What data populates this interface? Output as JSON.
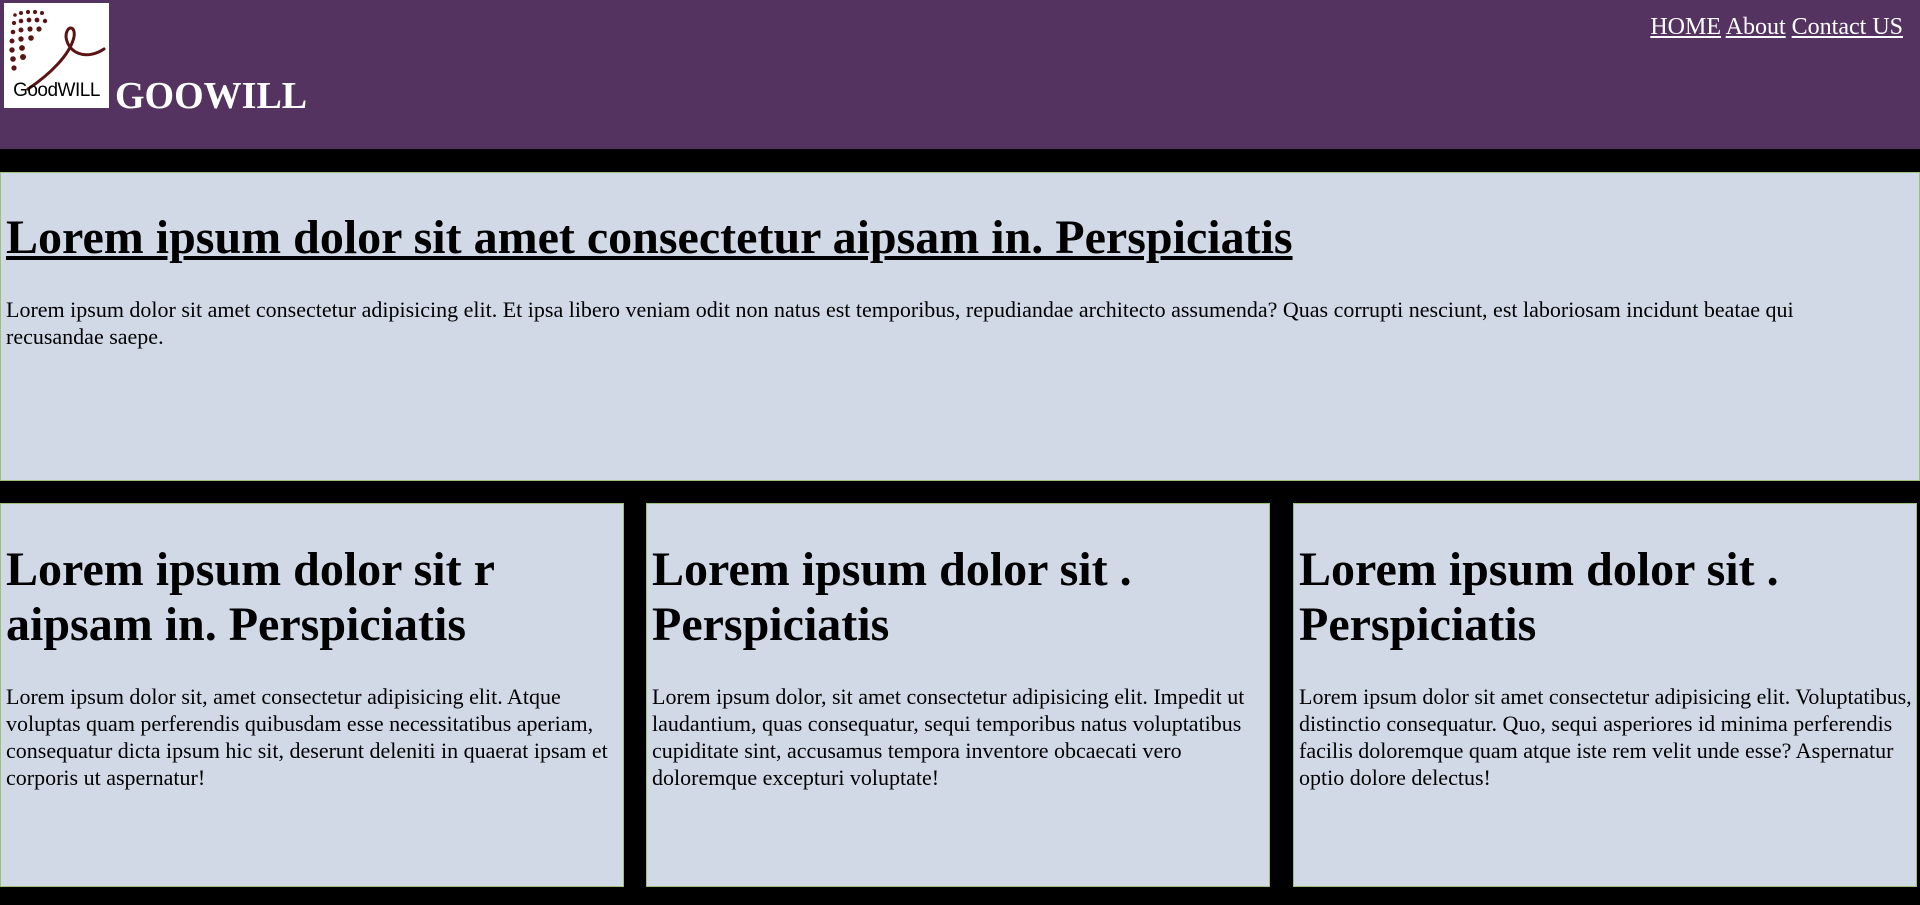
{
  "header": {
    "logo_text": "GoodWILL",
    "brand": "GOOWILL",
    "nav": [
      "HOME",
      "About",
      "Contact US"
    ]
  },
  "hero": {
    "title": "Lorem ipsum dolor sit amet consectetur aipsam in. Perspiciatis",
    "body": "Lorem ipsum dolor sit amet consectetur adipisicing elit. Et ipsa libero veniam odit non natus est temporibus, repudiandae architecto assumenda? Quas corrupti nesciunt, est laboriosam incidunt beatae qui recusandae saepe."
  },
  "cards": [
    {
      "title": "Lorem ipsum dolor sit r aipsam in. Perspiciatis",
      "body": "Lorem ipsum dolor sit, amet consectetur adipisicing elit. Atque voluptas quam perferendis quibusdam esse necessitatibus aperiam, consequatur dicta ipsum hic sit, deserunt deleniti in quaerat ipsam et corporis ut aspernatur!"
    },
    {
      "title": "Lorem ipsum dolor sit . Perspiciatis",
      "body": "Lorem ipsum dolor, sit amet consectetur adipisicing elit. Impedit ut laudantium, quas consequatur, sequi temporibus natus voluptatibus cupiditate sint, accusamus tempora inventore obcaecati vero doloremque excepturi voluptate!"
    },
    {
      "title": "Lorem ipsum dolor sit . Perspiciatis",
      "body": "Lorem ipsum dolor sit amet consectetur adipisicing elit. Voluptatibus, distinctio consequatur. Quo, sequi asperiores id minima perferendis facilis doloremque quam atque iste rem velit unde esse? Aspernatur optio dolore delectus!"
    }
  ],
  "colors": {
    "header_bg": "#553361",
    "page_bg": "#000000",
    "panel_bg": "#d1d9e7",
    "panel_border": "#9bc27b",
    "logo_accent": "#5a1414"
  }
}
